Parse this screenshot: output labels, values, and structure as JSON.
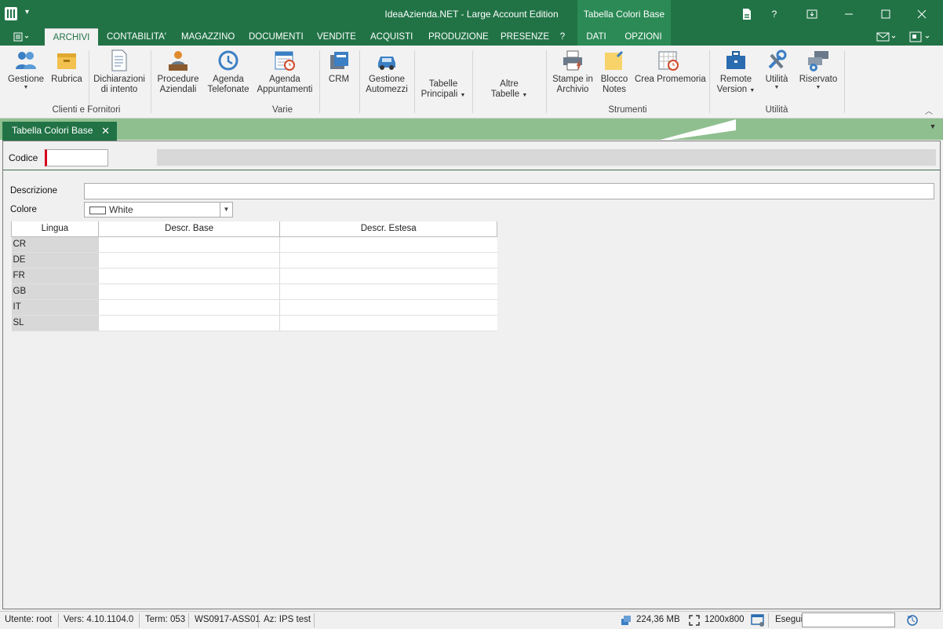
{
  "window": {
    "title": "IdeaAzienda.NET - Large Account Edition",
    "context_title": "Tabella Colori Base",
    "help_label": "?"
  },
  "ribbon_tabs": [
    "ARCHIVI",
    "CONTABILITA'",
    "MAGAZZINO",
    "DOCUMENTI",
    "VENDITE",
    "ACQUISTI",
    "PRODUZIONE",
    "PRESENZE",
    "?"
  ],
  "context_tabs": [
    "DATI",
    "OPZIONI"
  ],
  "ribbon": {
    "buttons": [
      {
        "label1": "Gestione",
        "label2": "",
        "arrow": true,
        "icon": "users-icon"
      },
      {
        "label1": "Rubrica",
        "label2": "",
        "arrow": false,
        "icon": "box-icon"
      },
      {
        "label1": "Dichiarazioni",
        "label2": "di intento",
        "arrow": false,
        "icon": "document-icon"
      },
      {
        "label1": "Procedure",
        "label2": "Aziendali",
        "arrow": false,
        "icon": "person-desk-icon"
      },
      {
        "label1": "Agenda",
        "label2": "Telefonate",
        "arrow": false,
        "icon": "history-icon"
      },
      {
        "label1": "Agenda",
        "label2": "Appuntamenti",
        "arrow": false,
        "icon": "calendar-clock-icon"
      },
      {
        "label1": "CRM",
        "label2": "",
        "arrow": false,
        "icon": "crm-icon"
      },
      {
        "label1": "Gestione",
        "label2": "Automezzi",
        "arrow": false,
        "icon": "car-icon"
      },
      {
        "label1": "Tabelle",
        "label2": "Principali",
        "arrow": true,
        "icon": ""
      },
      {
        "label1": "Altre",
        "label2": "Tabelle",
        "arrow": true,
        "icon": ""
      },
      {
        "label1": "Stampe in",
        "label2": "Archivio",
        "arrow": false,
        "icon": "printer-icon"
      },
      {
        "label1": "Blocco",
        "label2": "Notes",
        "arrow": false,
        "icon": "sticky-note-icon"
      },
      {
        "label1": "Crea Promemoria",
        "label2": "",
        "arrow": false,
        "icon": "reminder-icon"
      },
      {
        "label1": "Remote",
        "label2": "Version",
        "arrow": true,
        "icon": "briefcase-icon"
      },
      {
        "label1": "Utilità",
        "label2": "",
        "arrow": true,
        "icon": "tools-icon"
      },
      {
        "label1": "Riservato",
        "label2": "",
        "arrow": true,
        "icon": "gear-window-icon"
      }
    ],
    "groups": [
      "Clienti e Fornitori",
      "Varie",
      "Strumenti",
      "Utilità"
    ]
  },
  "doc_tab": {
    "label": "Tabella Colori Base",
    "close": "✕"
  },
  "form": {
    "codice_label": "Codice",
    "codice_value": "",
    "descrizione_label": "Descrizione",
    "descrizione_value": "",
    "colore_label": "Colore",
    "colore_value": "White",
    "colore_swatch": "#ffffff"
  },
  "grid": {
    "columns": [
      "Lingua",
      "Descr. Base",
      "Descr. Estesa"
    ],
    "rows": [
      {
        "lang": "CR",
        "base": "",
        "extended": ""
      },
      {
        "lang": "DE",
        "base": "",
        "extended": ""
      },
      {
        "lang": "FR",
        "base": "",
        "extended": ""
      },
      {
        "lang": "GB",
        "base": "",
        "extended": ""
      },
      {
        "lang": "IT",
        "base": "",
        "extended": ""
      },
      {
        "lang": "SL",
        "base": "",
        "extended": ""
      }
    ]
  },
  "status": {
    "user": "Utente: root",
    "version": "Vers: 4.10.1104.0",
    "term": "Term: 053",
    "ws": "WS0917-ASS01",
    "az": "Az: IPS test",
    "memory": "224,36 MB",
    "resolution": "1200x800",
    "exec_label": "Esegui",
    "exec_value": ""
  },
  "colors": {
    "accent": "#217346",
    "context": "#2b8a55",
    "doc_strip": "#8fbf8f"
  }
}
